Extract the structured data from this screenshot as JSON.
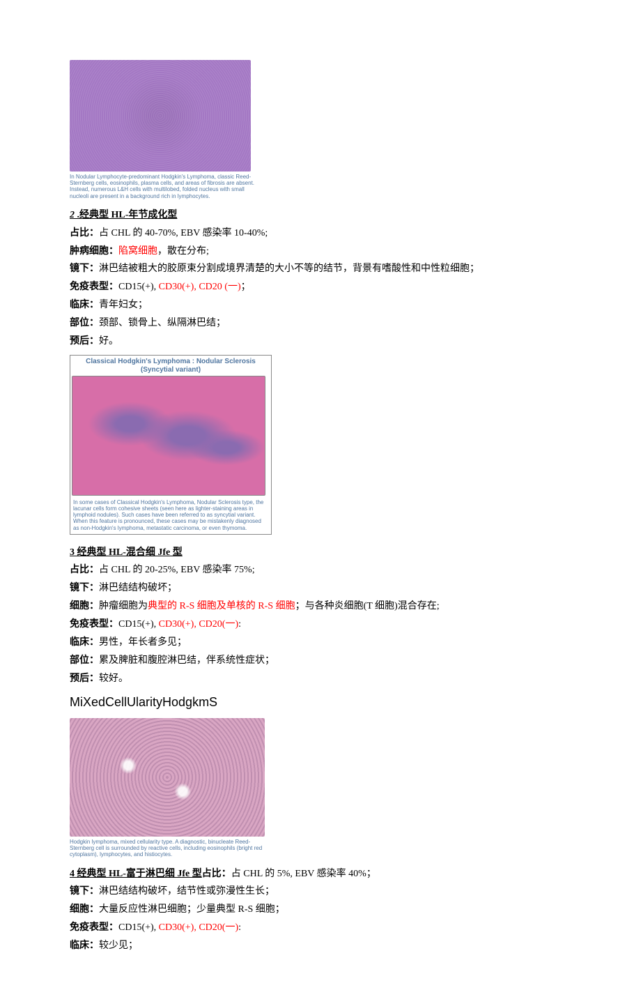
{
  "fig1": {
    "caption": "In Nodular Lymphocyte-predominant Hodgkin's Lymphoma, classic Reed-Sternberg cells, eosinophils, plasma cells, and areas of fibrosis are absent. Instead, numerous L&H cells with multilobed, folded nucleus with small nucleoli are present in a background rich in lymphocytes."
  },
  "sec2": {
    "num": "2 ",
    "title": ".经典型 HL-年节成化型",
    "l1a": "占比：",
    "l1b": "占 CHL 的 40-70%, EBV 感染率 10-40%;",
    "l2a": "肿病细胞：",
    "l2b": "陷窝细胞",
    "l2c": "，散在分布;",
    "l3a": "镜下：",
    "l3b": "淋巴结被粗大的胶原束分割成境界清楚的大小不等的结节，背景有嗜酸性和中性粒细胞；",
    "l4a": "免疫表型：",
    "l4b": "CD15(+), ",
    "l4c": "CD30(+), CD20 (一)",
    "l4d": "；",
    "l5a": "临床：",
    "l5b": "青年妇女；",
    "l6a": "部位：",
    "l6b": "颈部、锁骨上、纵隔淋巴结；",
    "l7a": "预后：",
    "l7b": "好。",
    "imgTitle": "Classical Hodgkin's Lymphoma : Nodular Sclerosis (Syncytial variant)",
    "imgCaption": "In some cases of Classical Hodgkin's Lymphoma, Nodular Sclerosis type, the lacunar cells form cohesive sheets (seen here as lighter-staining areas in lymphoid nodules). Such cases have been referred to as syncytial variant. When this feature is pronounced, these cases may be mistakenly diagnosed as non-Hodgkin's lymphoma, metastatic carcinoma, or even thymoma."
  },
  "sec3": {
    "title": "3 经典型 HL-混合细 Jfe 型",
    "l1a": "占比：",
    "l1b": "占 CHL 的 20-25%, EBV 感染率 75%;",
    "l2a": "镜下：",
    "l2b": "淋巴结结构破坏；",
    "l3a": "细胞：",
    "l3b": "肿瘤细胞为",
    "l3c": "典型的 R-S 细胞及单核的 R-S 细胞",
    "l3d": "；与各种炎细胞(T 细胞)混合存在;",
    "l4a": "免疫表型：",
    "l4b": "CD15(+), ",
    "l4c": "CD30(+), CD20(一)",
    "l4d": ":",
    "l5a": "临床：",
    "l5b": "男性，年长者多见；",
    "l6a": "部位：",
    "l6b": "累及脾脏和腹腔淋巴结，伴系统性症状；",
    "l7a": "预后：",
    "l7b": "较好。",
    "headline": "MiXedCellUlarityHodgkmS",
    "imgCaption": "Hodgkin lymphoma, mixed cellularity type. A diagnostic, binucleate Reed-Sternberg cell is surrounded by reactive cells, including eosinophils (bright red cytoplasm), lymphocytes, and histiocytes."
  },
  "sec4": {
    "title": "4 经典型 HL-富于淋巴细 Jfe 型",
    "l1a": "占比：",
    "l1b": "占 CHL 的 5%, EBV 感染率 40%；",
    "l2a": "镜下：",
    "l2b": "淋巴结结构破坏，结节性或弥漫性生长；",
    "l3a": "细胞：",
    "l3b": "大量反应性淋巴细胞；少量典型 R-S 细胞；",
    "l4a": "免疫表型：",
    "l4b": "CD15(+), ",
    "l4c": "CD30(+), CD20(一)",
    "l4d": ":",
    "l5a": "临床：",
    "l5b": "较少见；"
  }
}
